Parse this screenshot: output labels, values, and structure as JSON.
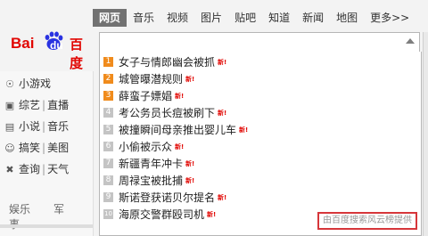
{
  "nav": {
    "items": [
      "网页",
      "音乐",
      "视频",
      "图片",
      "贴吧",
      "知道",
      "新闻",
      "地图",
      "更多>>"
    ],
    "active_index": 0
  },
  "logo": {
    "left_text": "Bai",
    "paw_text": "du",
    "right_text": "百度"
  },
  "search": {
    "value": "",
    "placeholder": ""
  },
  "suggestions": [
    {
      "rank": "1",
      "text": "女子与情郎幽会被抓",
      "badge": "新!"
    },
    {
      "rank": "2",
      "text": "城管曝潜规则",
      "badge": "新!"
    },
    {
      "rank": "3",
      "text": "薛蛮子嫖娼",
      "badge": "新!"
    },
    {
      "rank": "4",
      "text": "考公务员长痘被刷下",
      "badge": "新!"
    },
    {
      "rank": "5",
      "text": "被撞瞬间母亲推出婴儿车",
      "badge": "新!"
    },
    {
      "rank": "6",
      "text": "小偷被示众",
      "badge": "新!"
    },
    {
      "rank": "7",
      "text": "新疆青年冲卡",
      "badge": "新!"
    },
    {
      "rank": "8",
      "text": "周禄宝被批捕",
      "badge": "新!"
    },
    {
      "rank": "9",
      "text": "斯诺登获诺贝尔提名",
      "badge": "新!"
    },
    {
      "rank": "10",
      "text": "海原交警群殴司机",
      "badge": "新!"
    }
  ],
  "attribution": "由百度搜索风云榜提供",
  "sidebar": {
    "rows": [
      {
        "icon": "gamepad-icon",
        "a": "小游戏",
        "b": ""
      },
      {
        "icon": "tv-icon",
        "a": "综艺",
        "b": "直播"
      },
      {
        "icon": "book-icon",
        "a": "小说",
        "b": "音乐"
      },
      {
        "icon": "smile-icon",
        "a": "搞笑",
        "b": "美图"
      },
      {
        "icon": "tools-icon",
        "a": "查询",
        "b": "天气"
      }
    ],
    "tabs": [
      "娱乐",
      "军事"
    ]
  },
  "colors": {
    "accent_red": "#e10602",
    "hot_rank": "#f08b1c",
    "cold_rank": "#c4c4c4",
    "nav_active_bg": "#727272",
    "highlight_box": "#d6363a"
  }
}
